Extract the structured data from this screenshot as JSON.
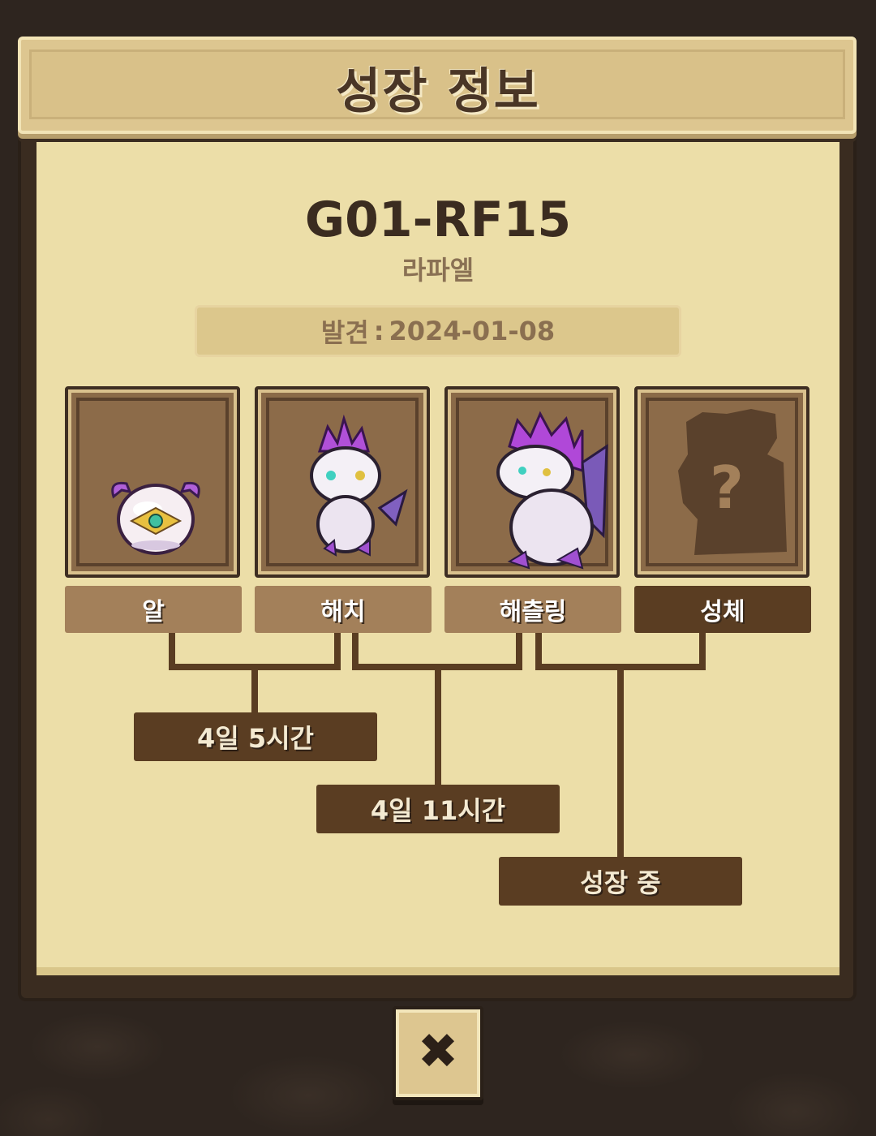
{
  "title": "성장 정보",
  "pet": {
    "id": "G01-RF15",
    "name": "라파엘",
    "discovered_label": "발견",
    "discovered_date": "2024-01-08"
  },
  "stages": [
    {
      "label": "알",
      "icon": "egg-icon",
      "unlocked": true
    },
    {
      "label": "해치",
      "icon": "hatchling-dragon-icon",
      "unlocked": true
    },
    {
      "label": "해츨링",
      "icon": "young-dragon-icon",
      "unlocked": true
    },
    {
      "label": "성체",
      "icon": "unknown-silhouette-icon",
      "unlocked": false,
      "mystery_mark": "?"
    }
  ],
  "durations": [
    "4일 5시간",
    "4일 11시간",
    "성장 중"
  ],
  "close": {
    "icon": "close-icon",
    "glyph": "✖"
  },
  "colors": {
    "parchment": "#ecdea8",
    "frame": "#3a2c20",
    "label_light": "#a3805a",
    "label_dark": "#5a3d22",
    "purple_accent": "#a040c8"
  }
}
